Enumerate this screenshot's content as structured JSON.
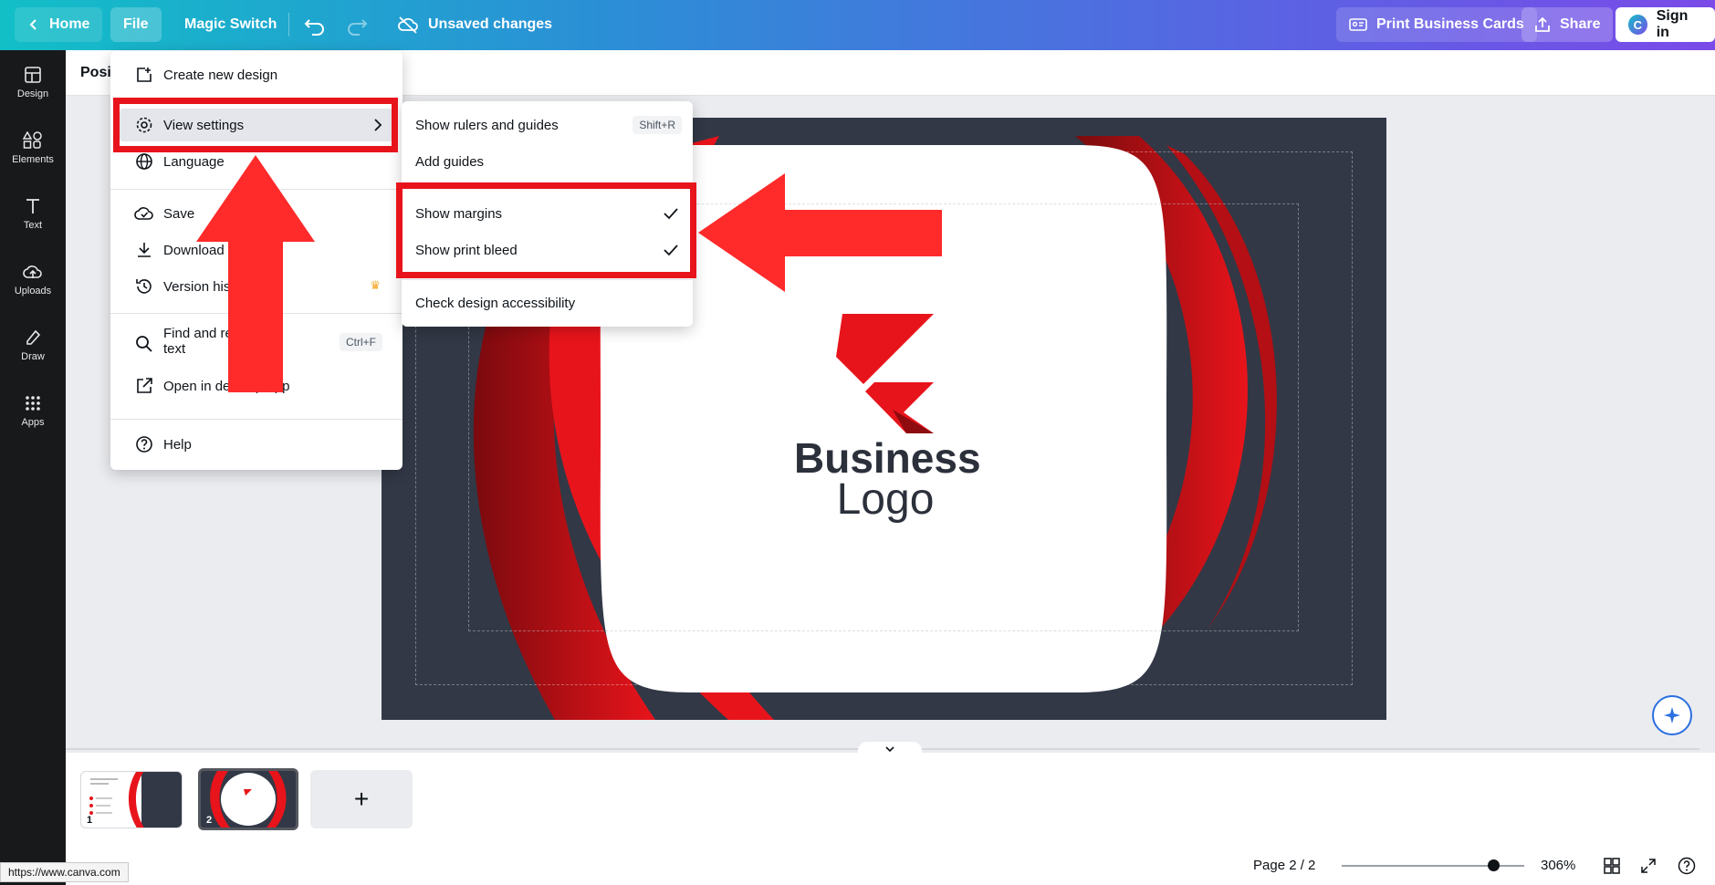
{
  "topbar": {
    "home": "Home",
    "file": "File",
    "magic_switch": "Magic Switch",
    "unsaved": "Unsaved changes",
    "print": "Print Business Cards",
    "share": "Share",
    "signin": "Sign in",
    "brand_badge": "C"
  },
  "rail": {
    "items": [
      {
        "label": "Design",
        "icon": "layout-icon"
      },
      {
        "label": "Elements",
        "icon": "shapes-icon"
      },
      {
        "label": "Text",
        "icon": "text-icon"
      },
      {
        "label": "Uploads",
        "icon": "cloud-upload-icon"
      },
      {
        "label": "Draw",
        "icon": "pen-icon"
      },
      {
        "label": "Apps",
        "icon": "grid-icon"
      }
    ]
  },
  "context": {
    "position": "Posit"
  },
  "file_menu": {
    "create": "Create new design",
    "view_settings": "View settings",
    "language": "Language",
    "save": "Save",
    "download": "Download",
    "version_history": "Version histo",
    "find_replace_1": "Find and rep",
    "find_replace_2": "text",
    "find_shortcut": "Ctrl+F",
    "open_desktop": "Open in desktop app",
    "help": "Help"
  },
  "view_menu": {
    "rulers": "Show rulers and guides",
    "rulers_shortcut": "Shift+R",
    "add_guides": "Add guides",
    "margins": "Show margins",
    "print_bleed": "Show print bleed",
    "accessibility": "Check design accessibility"
  },
  "design": {
    "logo_word1": "Business",
    "logo_word2": "Logo"
  },
  "pages": {
    "thumb1_num": "1",
    "thumb2_num": "2",
    "add": "+",
    "indicator": "Page 2 / 2",
    "zoom": "306%",
    "zoom_fraction": 0.83
  },
  "browser": {
    "url": "https://www.canva.com"
  },
  "colors": {
    "accent_red": "#e8141b",
    "canvas_dark": "#323846"
  }
}
